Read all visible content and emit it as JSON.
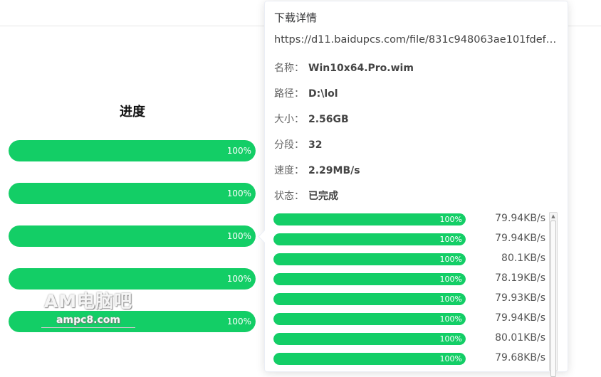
{
  "progress_column": {
    "header": "进度",
    "bars": [
      {
        "percent_label": "100%",
        "value": 100
      },
      {
        "percent_label": "100%",
        "value": 100
      },
      {
        "percent_label": "100%",
        "value": 100
      },
      {
        "percent_label": "100%",
        "value": 100
      },
      {
        "percent_label": "100%",
        "value": 100
      }
    ]
  },
  "watermark": {
    "title": "AM电脑吧",
    "url": "ampc8.com"
  },
  "download_detail": {
    "title": "下载详情",
    "url": "https://d11.baidupcs.com/file/831c948063ae101fdef6...",
    "fields": [
      {
        "label": "名称：",
        "value": "Win10x64.Pro.wim"
      },
      {
        "label": "路径：",
        "value": "D:\\lol"
      },
      {
        "label": "大小：",
        "value": "2.56GB"
      },
      {
        "label": "分段：",
        "value": "32"
      },
      {
        "label": "速度：",
        "value": "2.29MB/s"
      },
      {
        "label": "状态：",
        "value": "已完成"
      }
    ],
    "segments": [
      {
        "percent_label": "100%",
        "value": 100,
        "speed": "79.94KB/s"
      },
      {
        "percent_label": "100%",
        "value": 100,
        "speed": "79.94KB/s"
      },
      {
        "percent_label": "100%",
        "value": 100,
        "speed": "80.1KB/s"
      },
      {
        "percent_label": "100%",
        "value": 100,
        "speed": "78.19KB/s"
      },
      {
        "percent_label": "100%",
        "value": 100,
        "speed": "79.93KB/s"
      },
      {
        "percent_label": "100%",
        "value": 100,
        "speed": "79.94KB/s"
      },
      {
        "percent_label": "100%",
        "value": 100,
        "speed": "80.01KB/s"
      },
      {
        "percent_label": "100%",
        "value": 100,
        "speed": "79.68KB/s"
      }
    ]
  },
  "colors": {
    "progress_green": "#13ce66",
    "track": "#e9e9e9"
  },
  "icons": {
    "scroll_up": "scroll-up-arrow-icon"
  }
}
